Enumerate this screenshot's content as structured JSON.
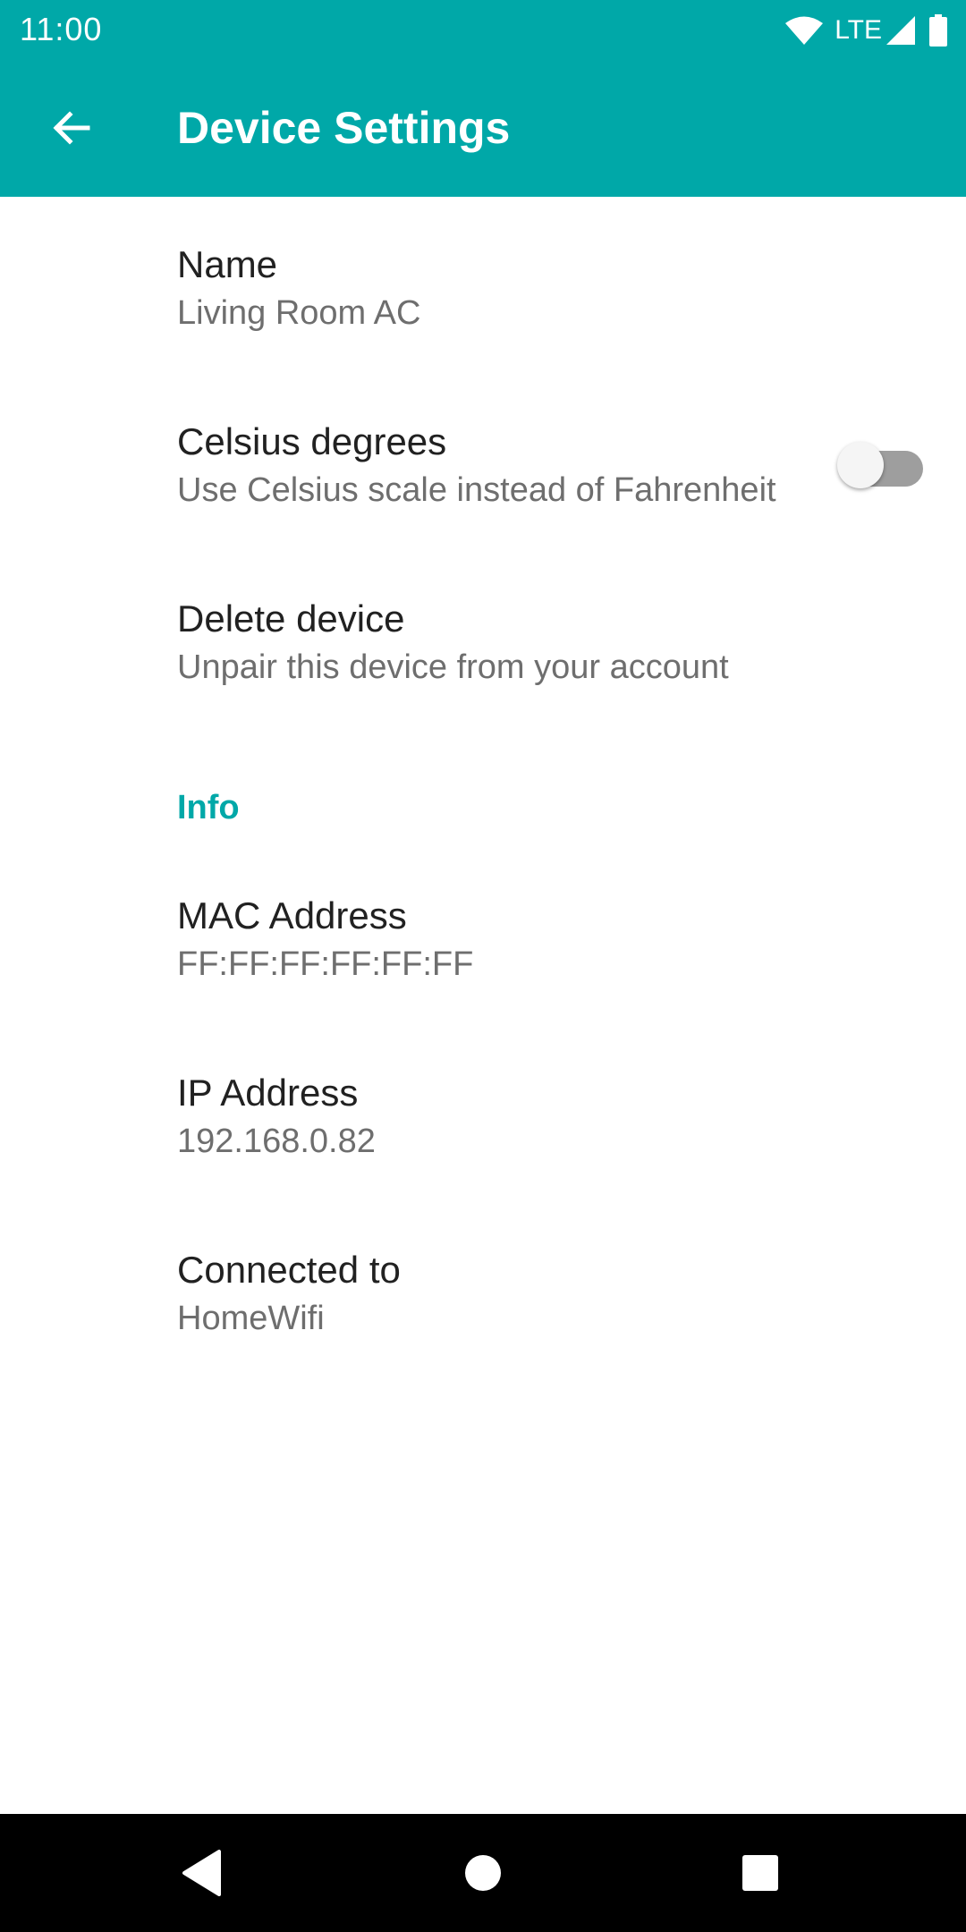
{
  "status_bar": {
    "time": "11:00",
    "network_label": "LTE",
    "icons": [
      "wifi-icon",
      "signal-icon",
      "battery-icon"
    ]
  },
  "app_bar": {
    "title": "Device Settings",
    "back_icon": "arrow-back-icon",
    "background_color": "#00a8a8"
  },
  "preferences": {
    "name": {
      "title": "Name",
      "summary": "Living Room AC"
    },
    "celsius": {
      "title": "Celsius degrees",
      "summary": "Use Celsius scale instead of Fahrenheit",
      "enabled": false
    },
    "delete": {
      "title": "Delete device",
      "summary": "Unpair this device from your account"
    }
  },
  "info": {
    "category_title": "Info",
    "accent_color": "#00a8a8",
    "mac": {
      "title": "MAC Address",
      "summary": "FF:FF:FF:FF:FF:FF"
    },
    "ip": {
      "title": "IP Address",
      "summary": "192.168.0.82"
    },
    "network": {
      "title": "Connected to",
      "summary": "HomeWifi"
    }
  },
  "nav_bar": {
    "icons": [
      "nav-back-icon",
      "nav-home-icon",
      "nav-recents-icon"
    ]
  }
}
